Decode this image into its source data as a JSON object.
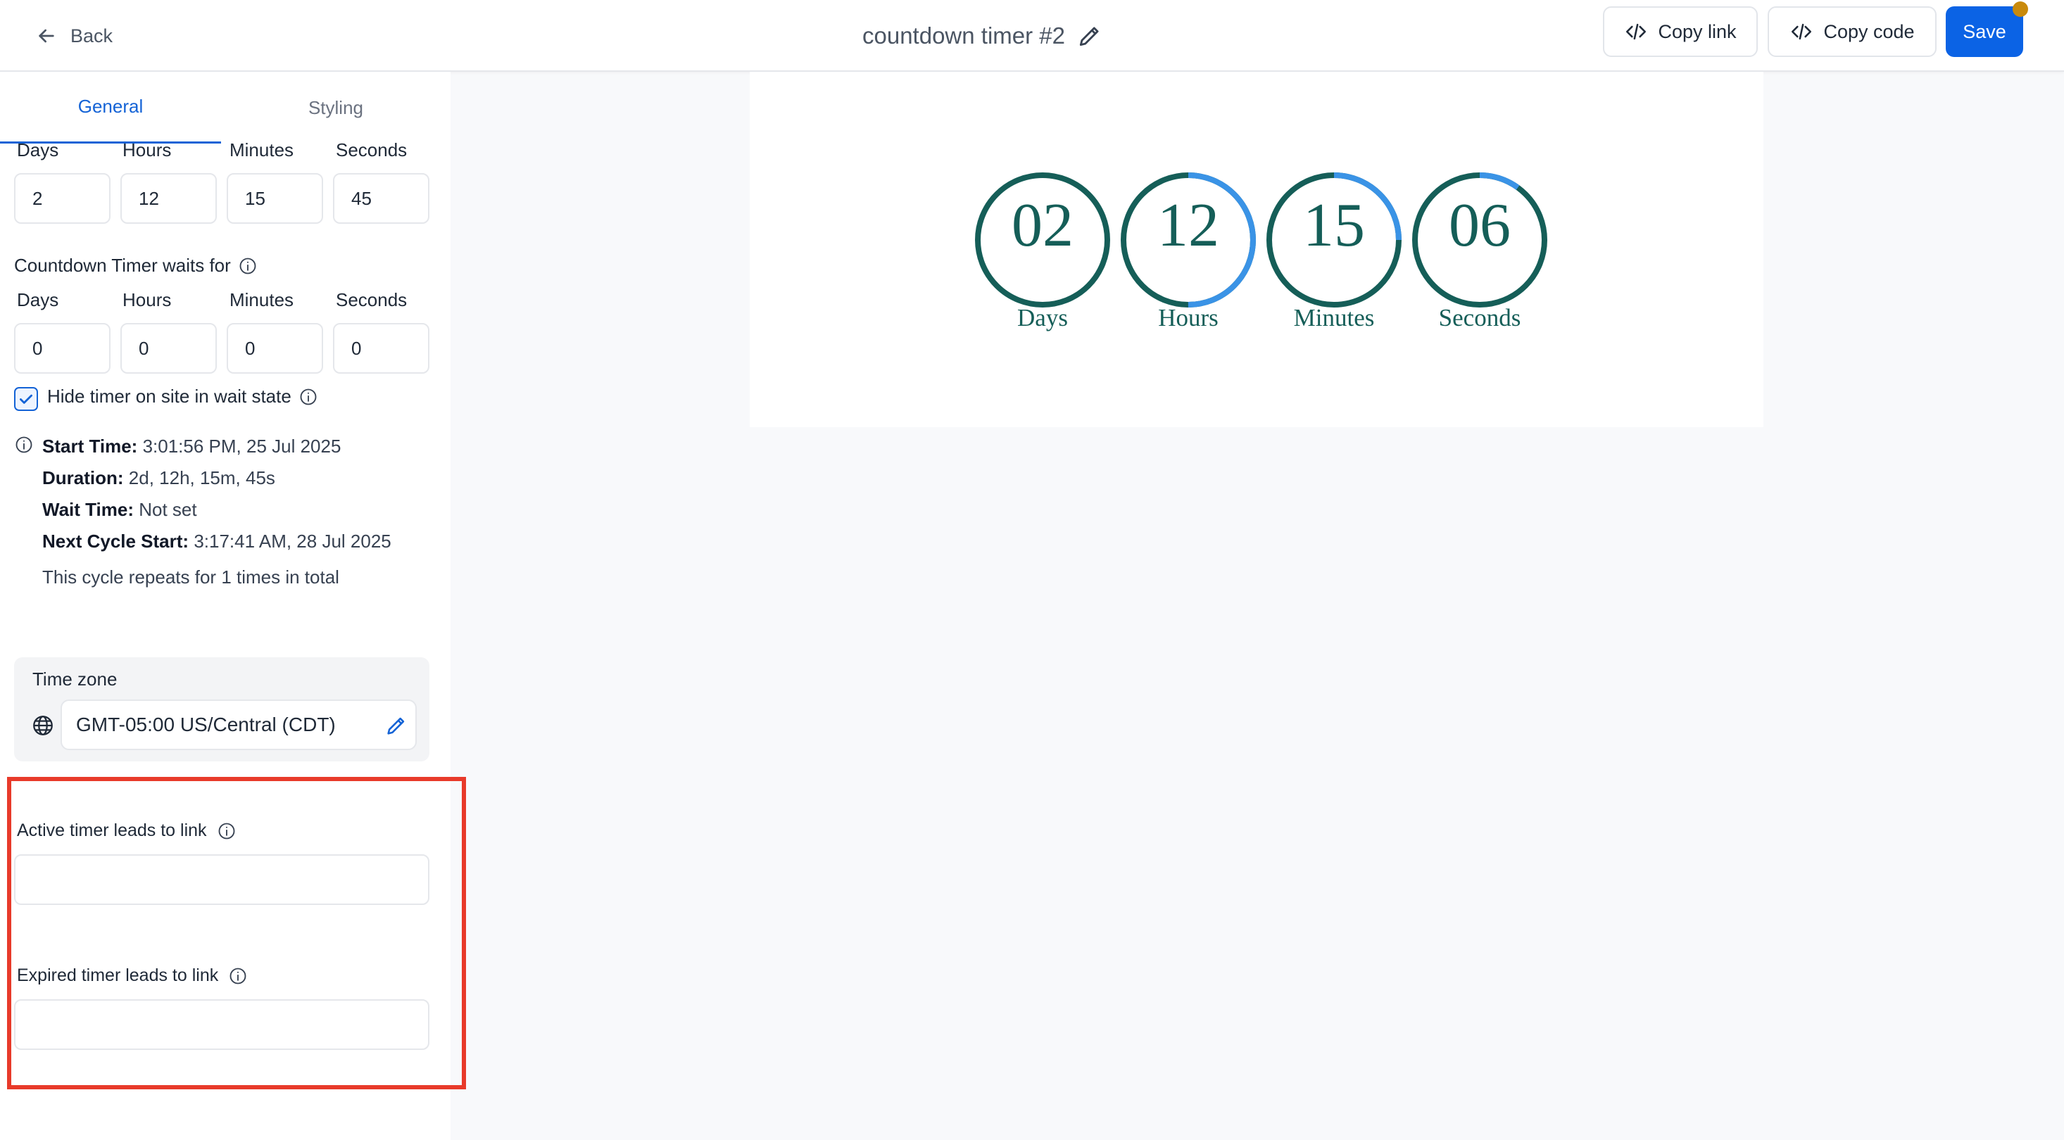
{
  "header": {
    "back_label": "Back",
    "title": "countdown timer #2",
    "copy_link_label": "Copy link",
    "copy_code_label": "Copy code",
    "save_label": "Save"
  },
  "tabs": [
    {
      "label": "General",
      "active": true
    },
    {
      "label": "Styling",
      "active": false
    }
  ],
  "duration": {
    "labels": [
      "Days",
      "Hours",
      "Minutes",
      "Seconds"
    ],
    "values": [
      "2",
      "12",
      "15",
      "45"
    ]
  },
  "wait": {
    "title": "Countdown Timer waits for",
    "labels": [
      "Days",
      "Hours",
      "Minutes",
      "Seconds"
    ],
    "values": [
      "0",
      "0",
      "0",
      "0"
    ]
  },
  "hide_timer": {
    "label": "Hide timer on site in wait state",
    "checked": true
  },
  "schedule": {
    "start_label": "Start Time:",
    "start_value": "3:01:56 PM, 25 Jul 2025",
    "duration_label": "Duration:",
    "duration_value": "2d, 12h, 15m, 45s",
    "wait_label": "Wait Time:",
    "wait_value": "Not set",
    "next_label": "Next Cycle Start:",
    "next_value": "3:17:41 AM, 28 Jul 2025",
    "repeat_text": "This cycle repeats for 1 times in total"
  },
  "timezone": {
    "label": "Time zone",
    "value": "GMT-05:00 US/Central (CDT)"
  },
  "links": {
    "active_label": "Active timer leads to link",
    "active_value": "",
    "expired_label": "Expired timer leads to link",
    "expired_value": ""
  },
  "preview": {
    "units": [
      {
        "number": "02",
        "label": "Days",
        "progress": 0.0
      },
      {
        "number": "12",
        "label": "Hours",
        "progress": 0.5
      },
      {
        "number": "15",
        "label": "Minutes",
        "progress": 0.25
      },
      {
        "number": "06",
        "label": "Seconds",
        "progress": 0.1
      }
    ],
    "ring_track_color": "#155e58",
    "ring_progress_color": "#3a93e6"
  },
  "colors": {
    "accent": "#0b63e5",
    "notification": "#c98a0c",
    "highlight": "#e83a2a"
  }
}
